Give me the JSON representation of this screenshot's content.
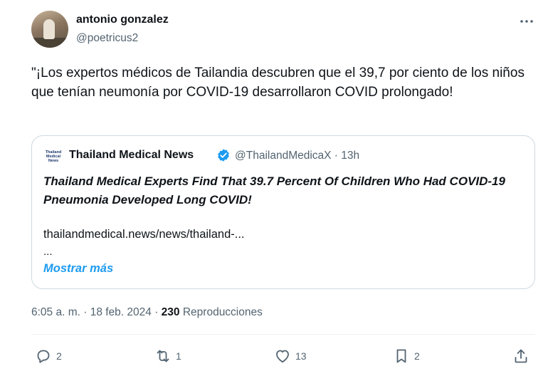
{
  "author": {
    "name": "antonio gonzalez",
    "handle": "@poetricus2"
  },
  "tweet": {
    "text": "\"¡Los expertos médicos de Tailandia descubren que el 39,7 por ciento de los niños que tenían neumonía por COVID-19 desarrollaron COVID prolongado!"
  },
  "quote": {
    "logo_lines": [
      "Thailand",
      "Medical",
      "News"
    ],
    "name": "Thailand Medical News",
    "handle_time": "@ThailandMedicaX · 13h",
    "title": "Thailand Medical Experts Find That 39.7 Percent Of Children Who Had COVID-19 Pneumonia Developed Long COVID!",
    "link": "thailandmedical.news/news/thailand-...",
    "ellipsis": "...",
    "show_more": "Mostrar más"
  },
  "meta": {
    "timestamp": "6:05 a. m. · 18 feb. 2024 · ",
    "views_count": "230",
    "views_label": " Reproducciones"
  },
  "actions": {
    "reply_count": "2",
    "retweet_count": "1",
    "like_count": "13",
    "bookmark_count": "2"
  },
  "icons": {
    "more": "more-horizontal-icon",
    "verified": "verified-badge-icon",
    "reply": "reply-icon",
    "retweet": "retweet-icon",
    "like": "heart-icon",
    "bookmark": "bookmark-icon",
    "share": "share-icon"
  },
  "colors": {
    "text": "#0f1419",
    "secondary": "#536471",
    "accent": "#1d9bf0",
    "border": "#cfd9de"
  }
}
